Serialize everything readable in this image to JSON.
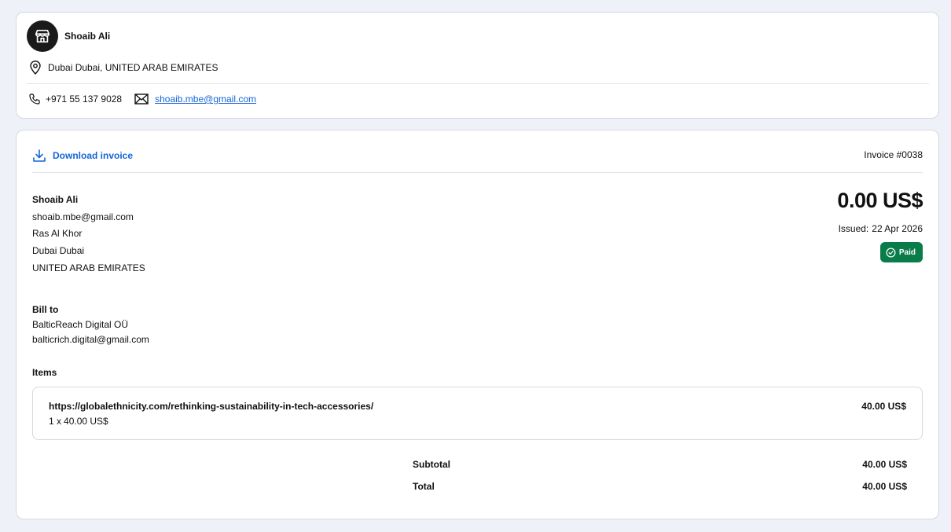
{
  "seller": {
    "name": "Shoaib Ali",
    "avatar_icon": "store-icon",
    "location": "Dubai Dubai, UNITED ARAB EMIRATES",
    "phone": "+971 55 137 9028",
    "email": "shoaib.mbe@gmail.com"
  },
  "invoice": {
    "download_label": "Download invoice",
    "number": "Invoice #0038",
    "from": {
      "name": "Shoaib Ali",
      "email": "shoaib.mbe@gmail.com",
      "address_line1": "Ras Al Khor",
      "city": "Dubai Dubai",
      "country": "UNITED ARAB EMIRATES"
    },
    "amount": "0.00 US$",
    "issued_label": "Issued:",
    "issued_date": "22 Apr 2026",
    "status": "Paid",
    "status_color": "#0a7c4a",
    "bill_to": {
      "label": "Bill to",
      "name": "BalticReach Digital OÜ",
      "email": "balticrich.digital@gmail.com"
    },
    "items_label": "Items",
    "items": [
      {
        "title": "https://globalethnicity.com/rethinking-sustainability-in-tech-accessories/",
        "quantity": "1 x",
        "unit_price": "40.00 US$",
        "total": "40.00 US$"
      }
    ],
    "subtotal_label": "Subtotal",
    "subtotal": "40.00 US$",
    "total_label": "Total",
    "total": "40.00 US$"
  },
  "colors": {
    "link": "#1565d8",
    "background": "#eef1f8"
  }
}
